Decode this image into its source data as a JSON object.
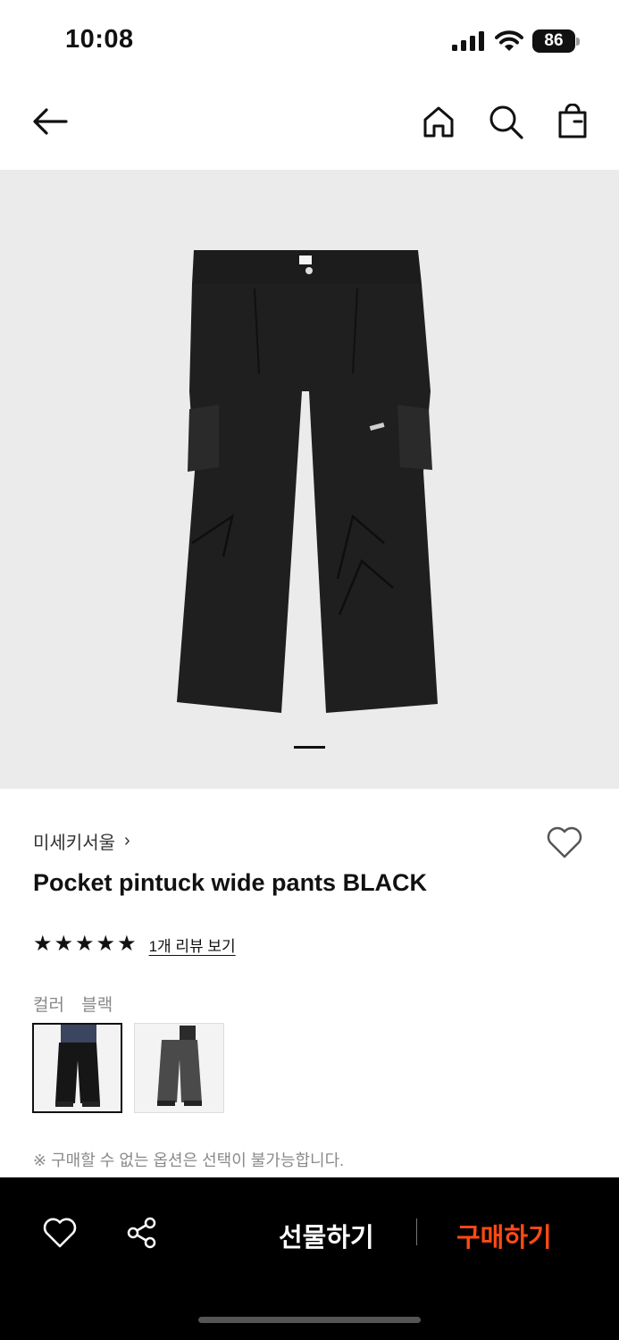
{
  "status_bar": {
    "time": "10:08",
    "battery": "86"
  },
  "nav": {
    "back_icon": "arrow-left-icon",
    "home_icon": "home-icon",
    "search_icon": "search-icon",
    "bag_icon": "shopping-bag-icon"
  },
  "gallery": {
    "image": "black cargo wide pants photo",
    "page_index": 1
  },
  "product": {
    "brand": "미세키서울",
    "brand_chevron": "›",
    "title": "Pocket pintuck wide pants BLACK",
    "rating_stars": 5,
    "review_link": "1개 리뷰 보기"
  },
  "options": {
    "label": "컬러",
    "selected_value": "블랙",
    "swatches": [
      {
        "name": "black",
        "selected": true
      },
      {
        "name": "charcoal",
        "selected": false
      }
    ],
    "notice": "※ 구매할 수 없는 옵션은 선택이 불가능합니다."
  },
  "bottom_bar": {
    "wish_icon": "heart-icon",
    "share_icon": "share-icon",
    "gift_label": "선물하기",
    "buy_label": "구매하기",
    "buy_color": "#ff4a14"
  }
}
